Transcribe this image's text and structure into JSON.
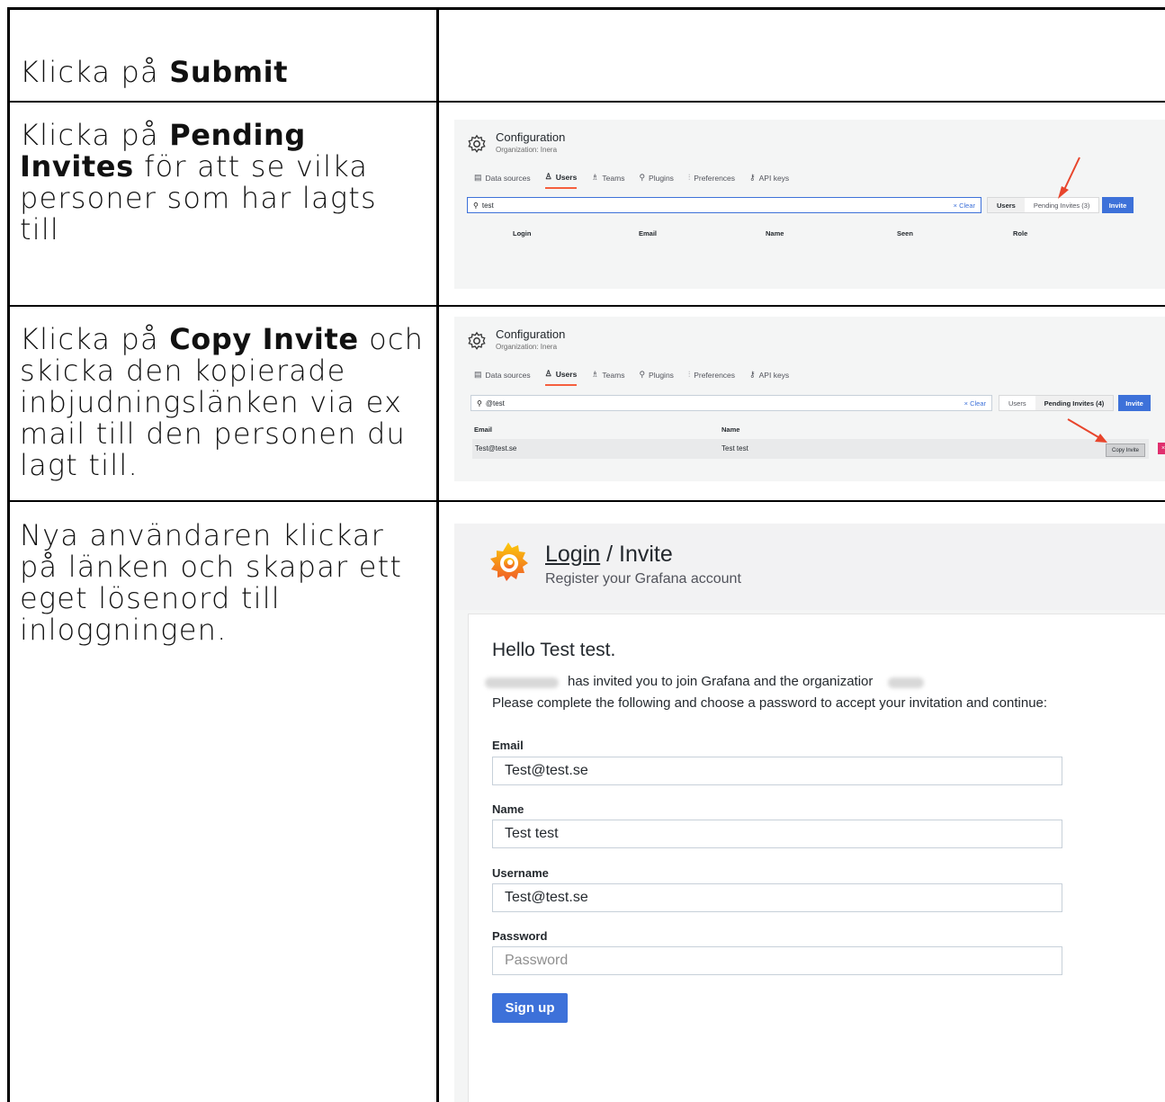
{
  "steps": {
    "submit": {
      "prefix": "Klicka på ",
      "bold": "Submit"
    },
    "pending": {
      "prefix": "Klicka på ",
      "bold": "Pending Invites",
      "suffix": " för att se vilka personer som har lagts till"
    },
    "copy": {
      "prefix": "Klicka på ",
      "bold": "Copy Invite",
      "suffix": " och skicka den kopierade inbjudningslänken via ex mail till den personen du lagt till."
    },
    "newuser": {
      "text": "Nya användaren klickar på länken och skapar ett eget lösenord till inloggningen."
    }
  },
  "config": {
    "title": "Configuration",
    "org": "Organization: Inera",
    "tabs": [
      "Data sources",
      "Users",
      "Teams",
      "Plugins",
      "Preferences",
      "API keys"
    ],
    "clear": "Clear",
    "users_label": "Users",
    "invite_label": "Invite"
  },
  "shot1": {
    "search_value": "test",
    "pending_label": "Pending Invites (3)",
    "columns": [
      "Login",
      "Email",
      "Name",
      "Seen",
      "Role"
    ]
  },
  "shot2": {
    "search_value": "@test",
    "pending_label": "Pending Invites (4)",
    "columns": [
      "Email",
      "Name"
    ],
    "row": {
      "email": "Test@test.se",
      "name": "Test test",
      "copy": "Copy Invite",
      "delete": "×"
    }
  },
  "login": {
    "link": "Login",
    "sep": " / Invite",
    "subtitle": "Register your Grafana account",
    "hello": "Hello Test test.",
    "invited": "has invited you to join Grafana and the organizatior",
    "instructions": "Please complete the following and choose a password to accept your invitation and continue:",
    "email_label": "Email",
    "email_value": "Test@test.se",
    "name_label": "Name",
    "name_value": "Test test",
    "username_label": "Username",
    "username_value": "Test@test.se",
    "password_label": "Password",
    "password_placeholder": "Password",
    "signup": "Sign up"
  },
  "colors": {
    "accent": "#3d71d9",
    "tab_underline": "#f55f3e",
    "arrow": "#e8452c",
    "delete": "#e02f6e"
  }
}
